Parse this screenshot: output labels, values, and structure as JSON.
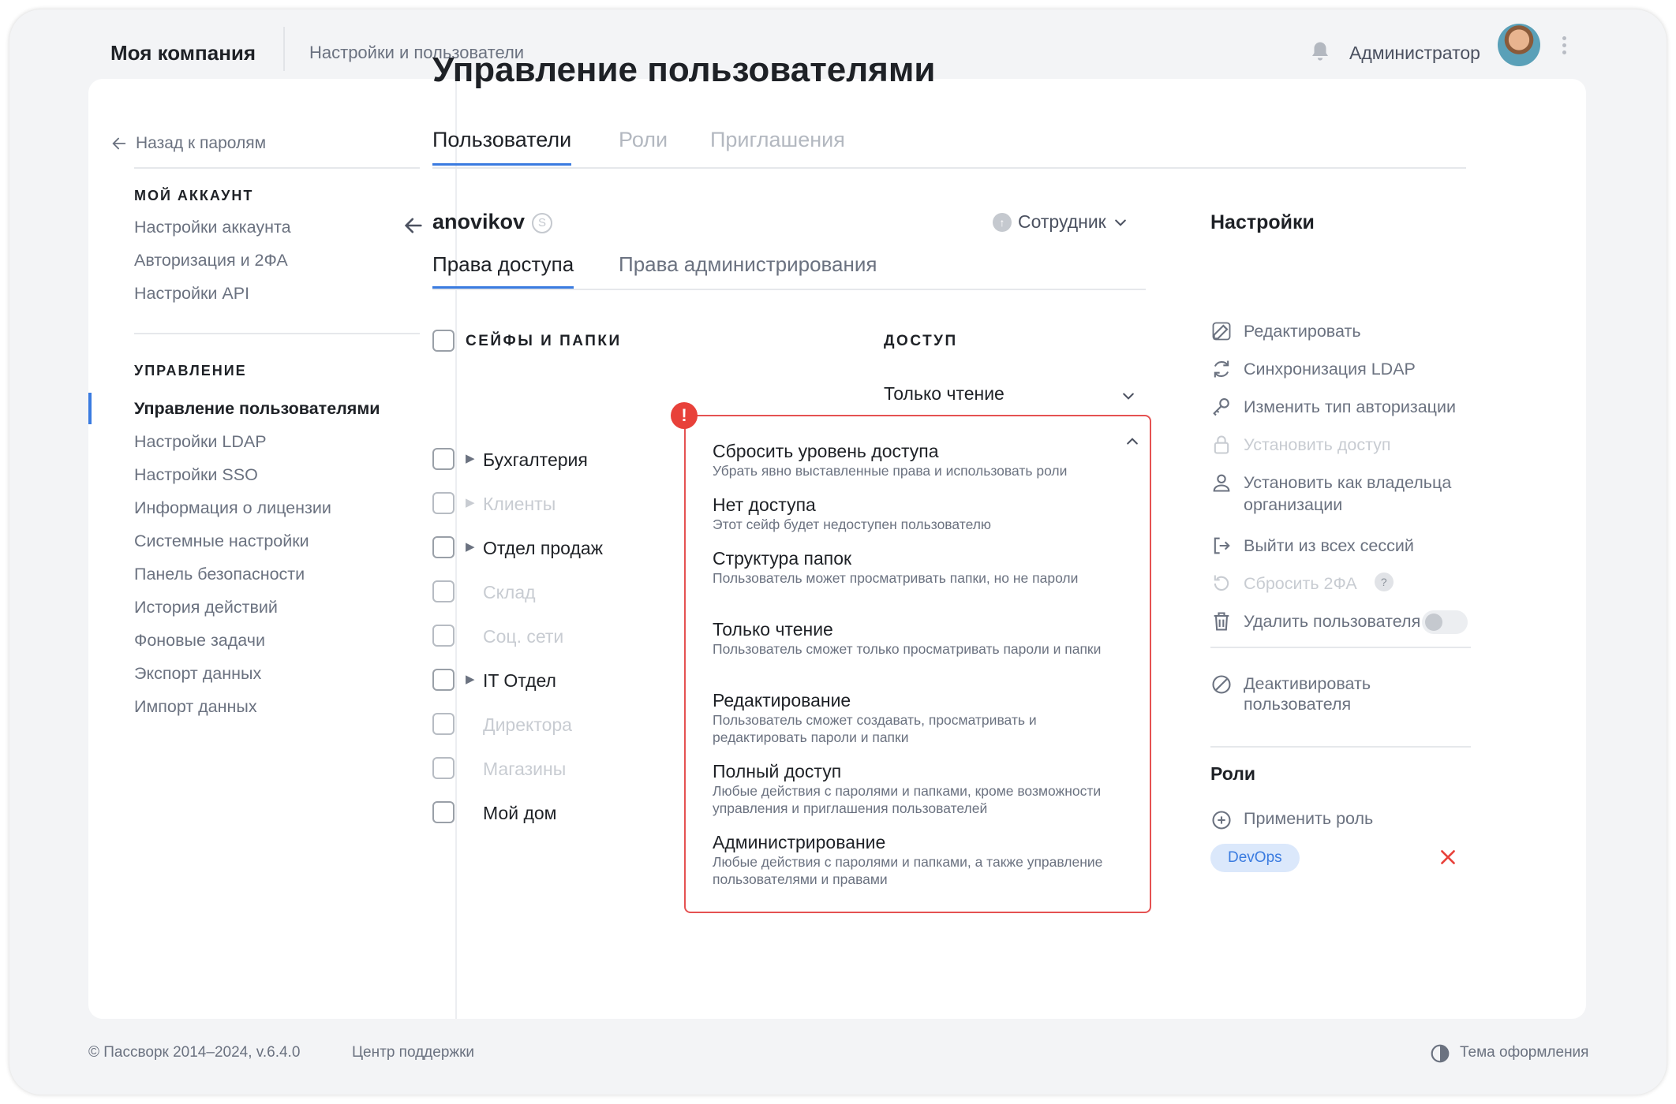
{
  "header": {
    "brand": "Моя компания",
    "breadcrumb": "Настройки и пользователи",
    "user_name": "Администратор"
  },
  "sidebar": {
    "back_label": "Назад к паролям",
    "account_heading": "МОЙ АККАУНТ",
    "account_items": [
      "Настройки аккаунта",
      "Авторизация и 2ФА",
      "Настройки API"
    ],
    "manage_heading": "УПРАВЛЕНИЕ",
    "manage_items": [
      "Управление пользователями",
      "Настройки LDAP",
      "Настройки SSO",
      "Информация о лицензии",
      "Системные настройки",
      "Панель безопасности",
      "История действий",
      "Фоновые задачи",
      "Экспорт данных",
      "Импорт данных"
    ],
    "active_index": 0
  },
  "main": {
    "title": "Управление пользователями",
    "tabs": [
      "Пользователи",
      "Роли",
      "Приглашения"
    ],
    "active_tab": 0,
    "user": {
      "login": "anovikov",
      "badge": "S",
      "role": "Сотрудник",
      "role_icon": "arrow-up-circle-icon"
    },
    "sub_tabs": [
      "Права доступа",
      "Права администрирования"
    ],
    "columns": {
      "folders": "СЕЙФЫ И ПАПКИ",
      "access": "ДОСТУП"
    },
    "folders": [
      {
        "name": "Бухгалтерия",
        "expandable": true,
        "muted": false
      },
      {
        "name": "Клиенты",
        "expandable": true,
        "muted": true
      },
      {
        "name": "Отдел продаж",
        "expandable": true,
        "muted": false
      },
      {
        "name": "Склад",
        "expandable": false,
        "muted": true
      },
      {
        "name": "Соц. сети",
        "expandable": false,
        "muted": true
      },
      {
        "name": "IT Отдел",
        "expandable": true,
        "muted": false
      },
      {
        "name": "Директора",
        "expandable": false,
        "muted": true
      },
      {
        "name": "Магазины",
        "expandable": false,
        "muted": true
      },
      {
        "name": "Мой дом",
        "expandable": false,
        "muted": false
      }
    ],
    "first_access_value": "Только чтение",
    "error_badge": "!",
    "dropdown_options": [
      {
        "title": "Сбросить уровень доступа",
        "desc": "Убрать явно выставленные права и использовать роли"
      },
      {
        "title": "Нет доступа",
        "desc": "Этот сейф будет недоступен пользователю"
      },
      {
        "title": "Структура папок",
        "desc": "Пользователь может просматривать папки, но не пароли"
      },
      {
        "title": "Только чтение",
        "desc": "Пользователь сможет только просматривать пароли и папки"
      },
      {
        "title": "Редактирование",
        "desc": "Пользователь сможет создавать, просматривать и редактировать пароли и папки"
      },
      {
        "title": "Полный доступ",
        "desc": "Любые действия с паролями и папками, кроме возможности управления и приглашения пользователей"
      },
      {
        "title": "Администрирование",
        "desc": "Любые действия с паролями и папками, а также управление пользователями и правами"
      }
    ]
  },
  "panel": {
    "settings_title": "Настройки",
    "actions": [
      {
        "label": "Редактировать",
        "icon": "edit-icon",
        "disabled": false
      },
      {
        "label": "Синхронизация LDAP",
        "icon": "sync-icon",
        "disabled": false
      },
      {
        "label": "Изменить тип авторизации",
        "icon": "key-icon",
        "disabled": false
      },
      {
        "label": "Установить доступ",
        "icon": "lock-icon",
        "disabled": true
      },
      {
        "label": "Установить как владельца организации",
        "icon": "user-icon",
        "disabled": false
      },
      {
        "label": "Выйти из всех сессий",
        "icon": "logout-icon",
        "disabled": false
      },
      {
        "label": "Сбросить 2ФА",
        "icon": "reset-icon",
        "disabled": true,
        "help": "?"
      },
      {
        "label": "Удалить пользователя",
        "icon": "trash-icon",
        "disabled": false
      }
    ],
    "deactivate_label": "Деактивировать пользователя",
    "deactivate_on": false,
    "roles_title": "Роли",
    "apply_role_label": "Применить роль",
    "roles": [
      "DevOps"
    ]
  },
  "footer": {
    "copyright": "© Пассворк 2014–2024, v.6.4.0",
    "support": "Центр поддержки",
    "theme": "Тема оформления"
  },
  "colors": {
    "accent": "#3a7be0",
    "error": "#e55252",
    "chip_bg": "#dbe8fb"
  }
}
